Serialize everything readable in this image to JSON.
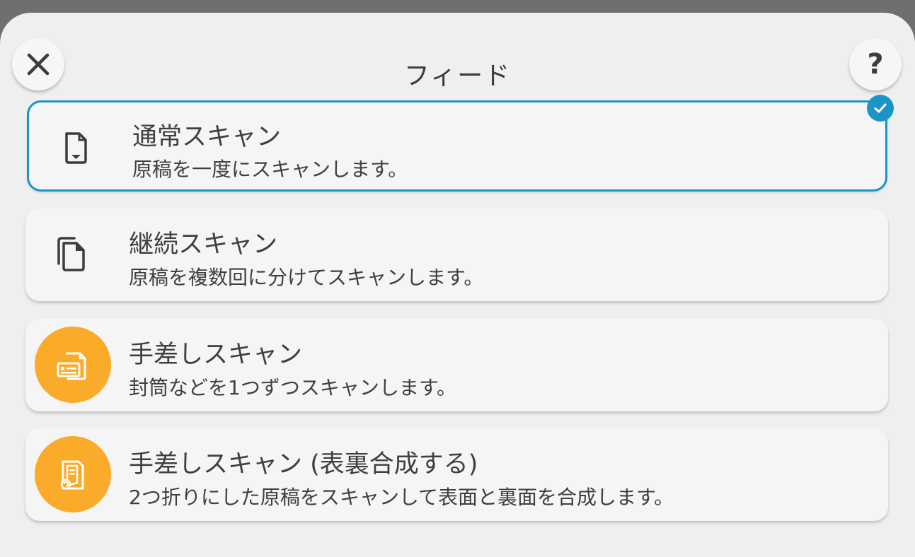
{
  "header": {
    "title": "フィード",
    "close_icon": "close-icon",
    "help_label": "?"
  },
  "options": [
    {
      "title": "通常スキャン",
      "description": "原稿を一度にスキャンします。",
      "icon": "single-document-icon",
      "selected": true
    },
    {
      "title": "継続スキャン",
      "description": "原稿を複数回に分けてスキャンします。",
      "icon": "multiple-documents-icon",
      "selected": false
    },
    {
      "title": "手差しスキャン",
      "description": "封筒などを1つずつスキャンします。",
      "icon": "manual-feed-icon",
      "selected": false
    },
    {
      "title": "手差しスキャン (表裏合成する)",
      "description": "2つ折りにした原稿をスキャンして表面と裏面を合成します。",
      "icon": "folded-merge-icon",
      "selected": false
    }
  ],
  "colors": {
    "accent": "#1b95c6",
    "orange": "#fbab2a",
    "panel": "#efefef",
    "text": "#3f3f3f"
  }
}
